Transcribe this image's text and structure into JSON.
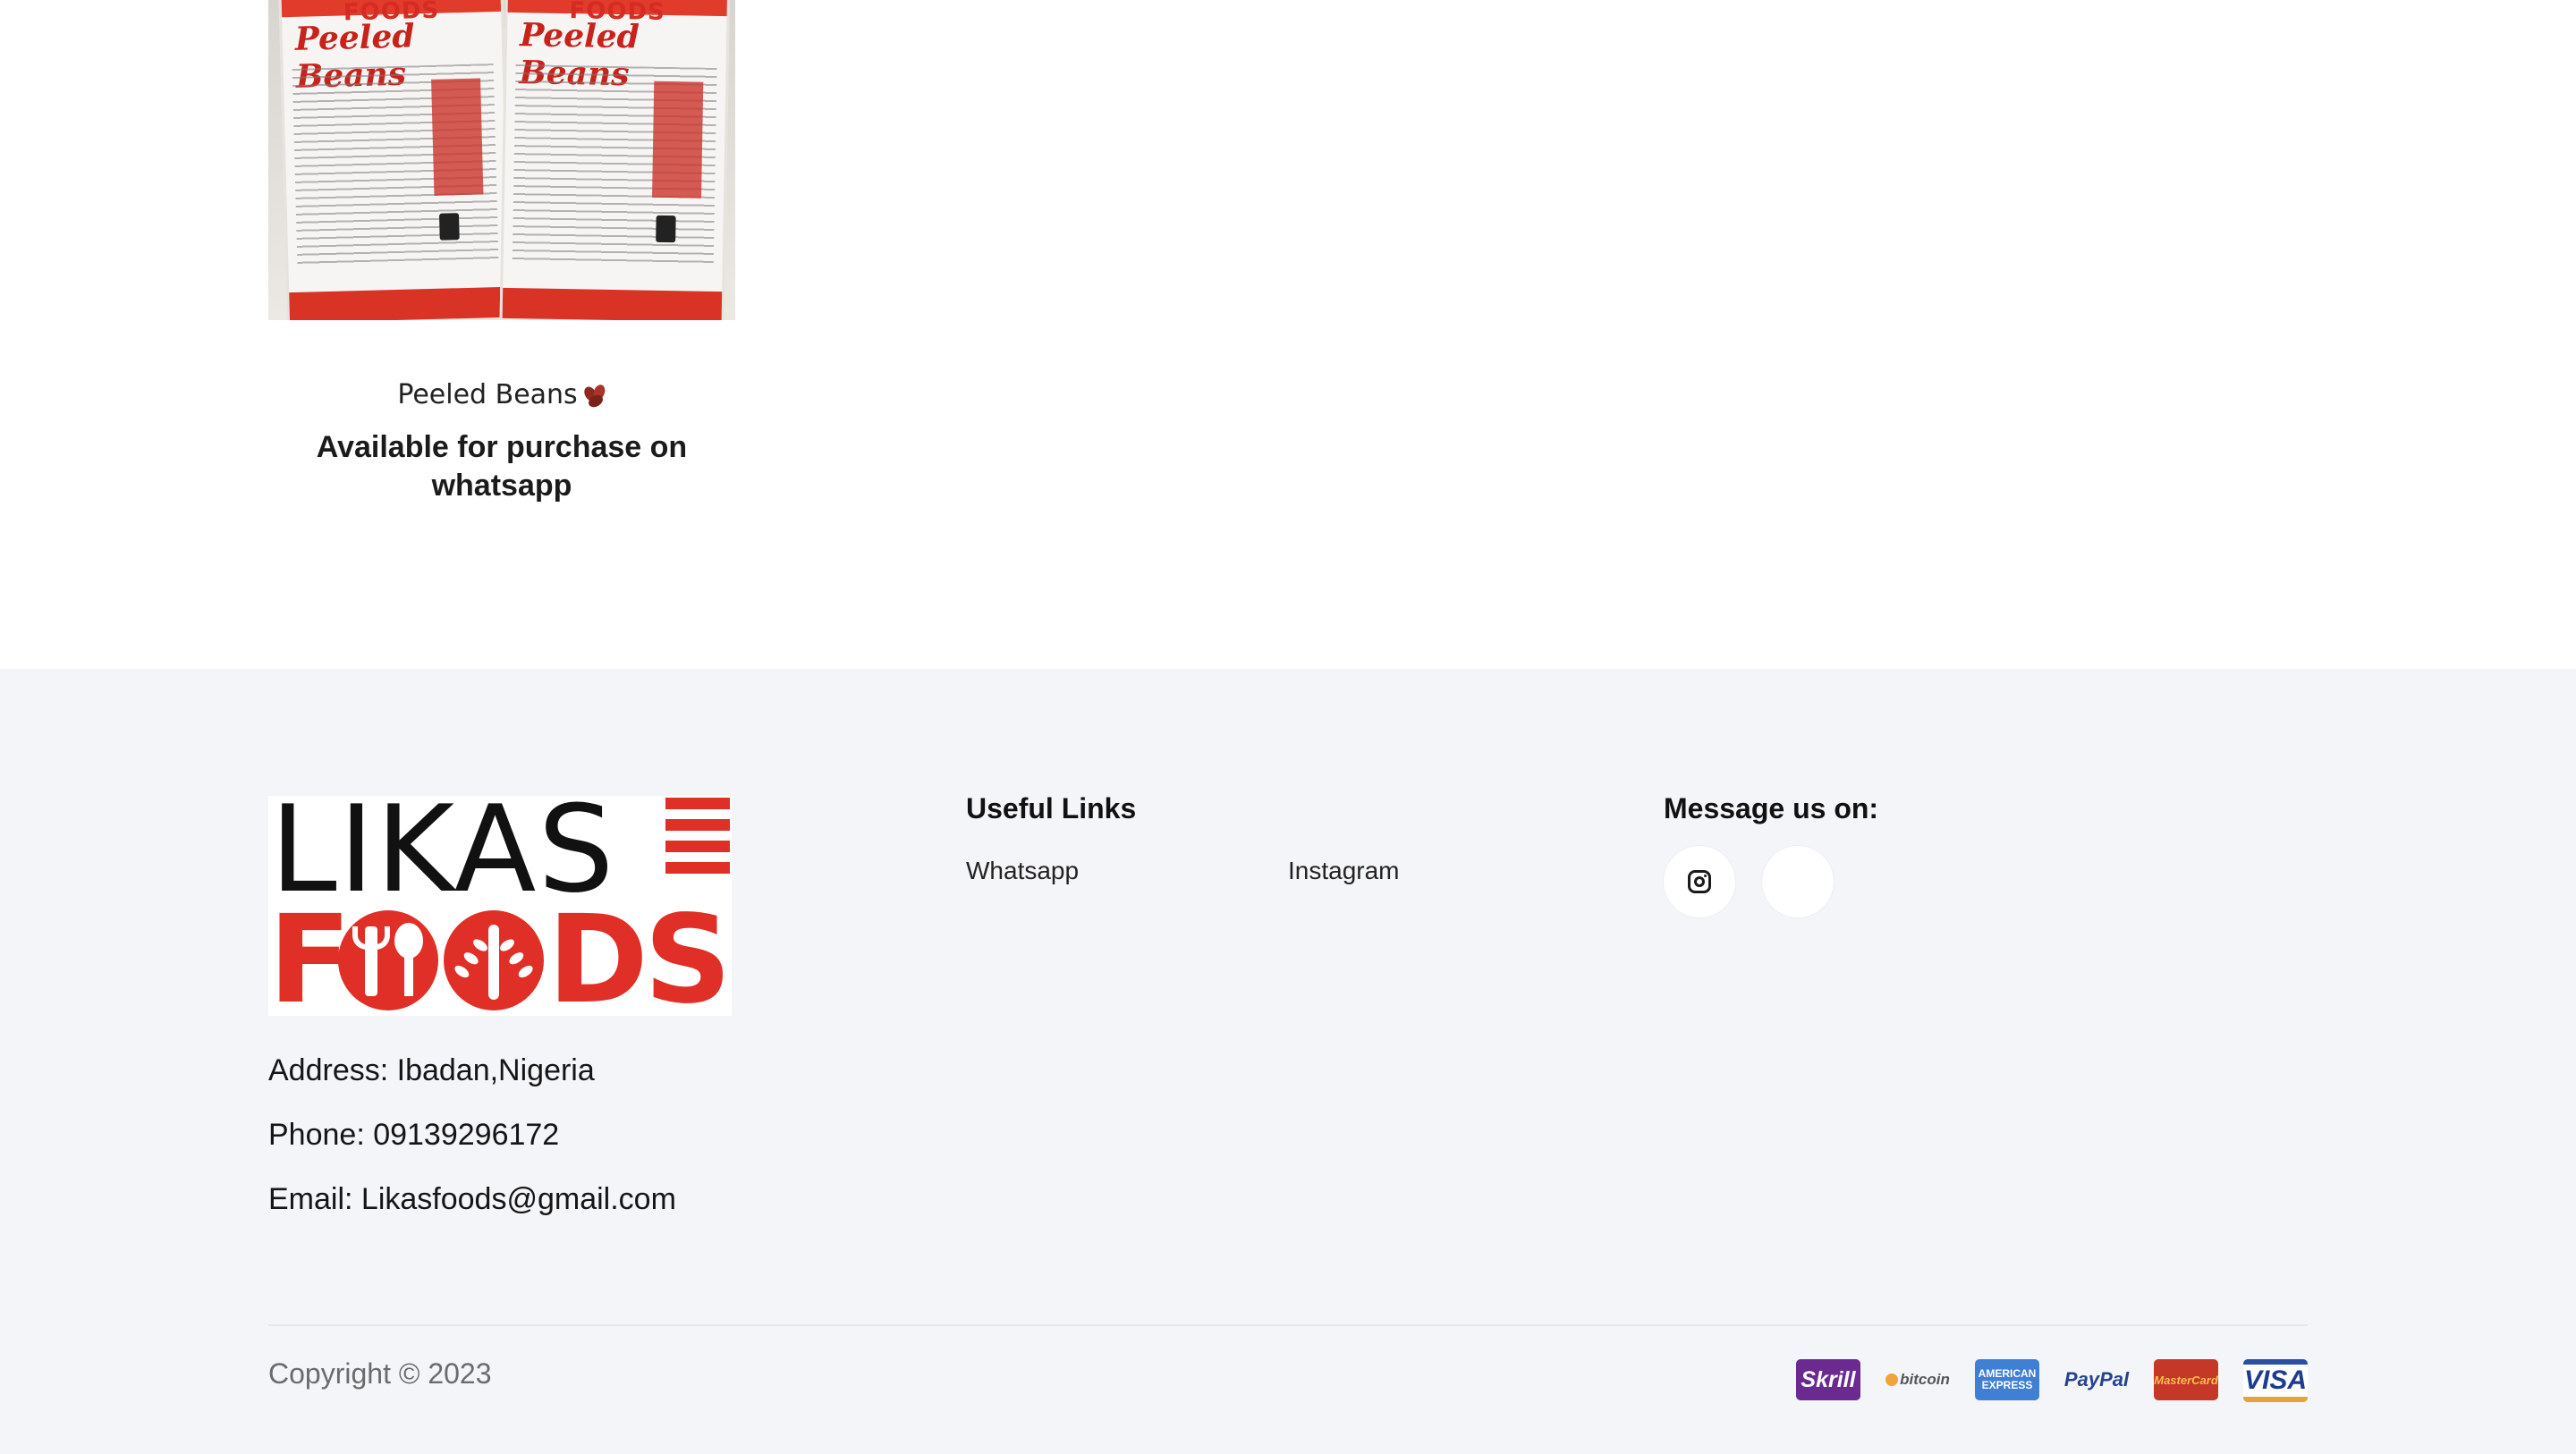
{
  "product": {
    "name": "Peeled Beans",
    "availability": "Available for purchase on whatsapp",
    "image_brand": "FOODS",
    "image_label": "Peeled Beans"
  },
  "footer": {
    "logo": {
      "line1": "LIKAS",
      "line2": "FOODS"
    },
    "address": "Address: Ibadan,Nigeria",
    "phone": "Phone: 09139296172",
    "email": "Email: Likasfoods@gmail.com",
    "useful_links": {
      "title": "Useful Links",
      "items": [
        {
          "label": "Whatsapp"
        },
        {
          "label": "Instagram"
        }
      ]
    },
    "message": {
      "title": "Message us on:",
      "icons": [
        "instagram-icon",
        "blank"
      ]
    },
    "copyright": "Copyright © 2023",
    "payment_methods": [
      "Skrill",
      "bitcoin",
      "AMERICAN EXPRESS",
      "PayPal",
      "MasterCard",
      "VISA"
    ]
  },
  "colors": {
    "brand_red": "#e02f26",
    "footer_bg": "#f4f5f8",
    "text_dark": "#111111"
  }
}
